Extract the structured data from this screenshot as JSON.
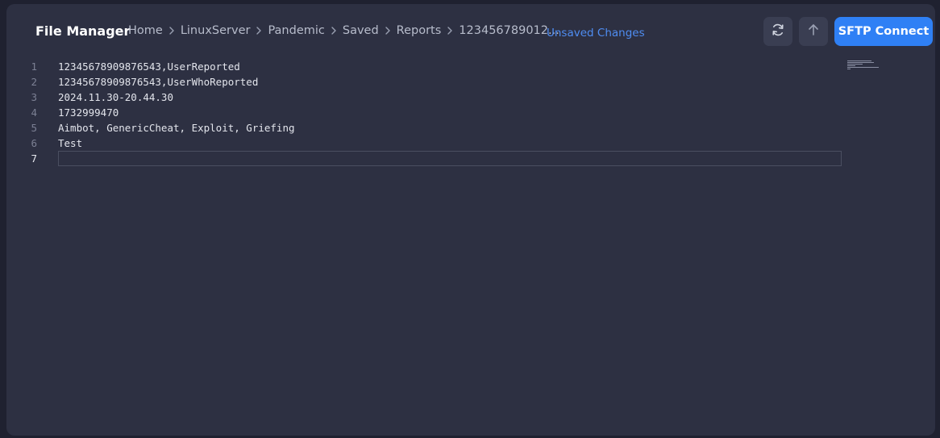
{
  "header": {
    "title": "File Manager",
    "breadcrumb": [
      "Home",
      "LinuxServer",
      "Pandemic",
      "Saved",
      "Reports",
      "123456789012..."
    ],
    "status": "Unsaved Changes",
    "sftp_label": "SFTP Connect",
    "refresh_icon": "refresh-icon",
    "upload_icon": "arrow-up-icon"
  },
  "editor": {
    "lines": [
      {
        "num": "1",
        "text": "12345678909876543,UserReported"
      },
      {
        "num": "2",
        "text": "12345678909876543,UserWhoReported"
      },
      {
        "num": "3",
        "text": "2024.11.30-20.44.30"
      },
      {
        "num": "4",
        "text": "1732999470"
      },
      {
        "num": "5",
        "text": "Aimbot, GenericCheat, Exploit, Griefing"
      },
      {
        "num": "6",
        "text": "Test"
      },
      {
        "num": "7",
        "text": ""
      }
    ],
    "active_line": 7
  },
  "colors": {
    "background": "#1f2130",
    "panel": "#2d3042",
    "accent": "#2f80f5",
    "status_link": "#4f8df2"
  }
}
